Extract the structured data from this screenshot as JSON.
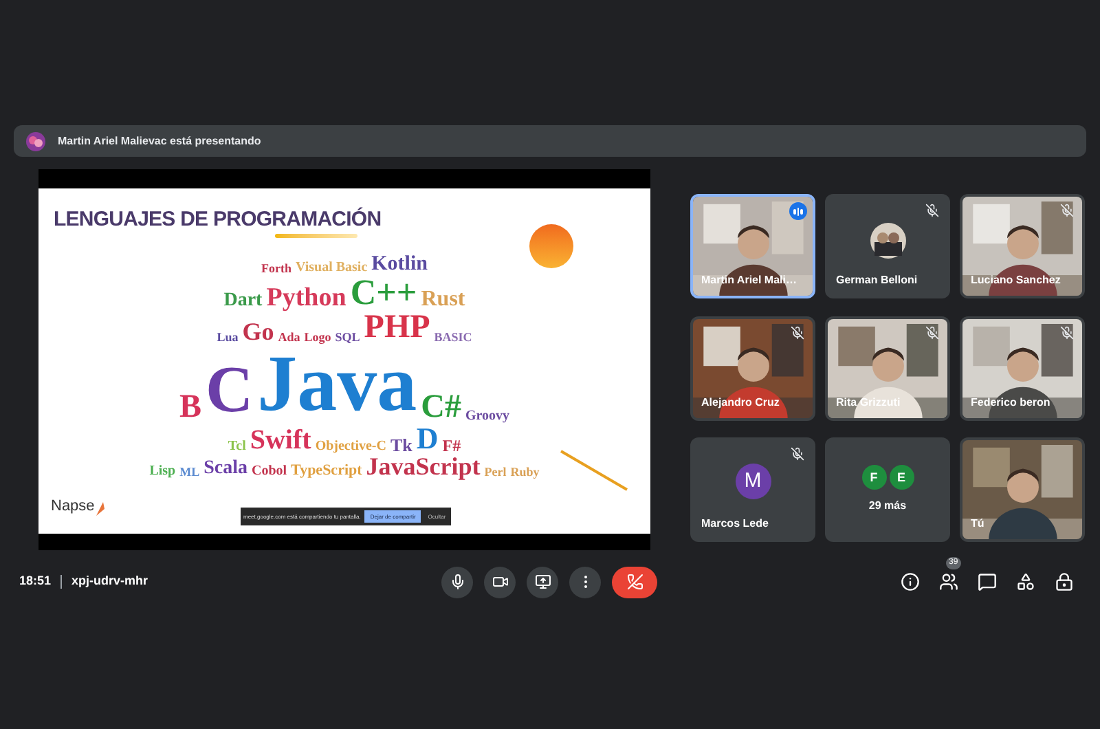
{
  "presenter_banner": {
    "text": "Martin Ariel Malievac está presentando"
  },
  "slide": {
    "title": "LENGUAJES DE PROGRAMACIÓN",
    "logo": "Napse",
    "word_rows": [
      [
        {
          "text": "Forth",
          "color": "#c2334d"
        },
        {
          "text": "Visual Basic",
          "color": "#e0b060"
        },
        {
          "text": "Kotlin",
          "color": "#5a4ba0"
        }
      ],
      [
        {
          "text": "Dart",
          "color": "#3a9a4a"
        },
        {
          "text": "Python",
          "color": "#d63a5a"
        },
        {
          "text": "C++",
          "color": "#2a9d3c"
        },
        {
          "text": "Rust",
          "color": "#d9a055"
        }
      ],
      [
        {
          "text": "Lua",
          "color": "#5a4ba0"
        },
        {
          "text": "Go",
          "color": "#c2334d"
        },
        {
          "text": "Ada",
          "color": "#c2334d"
        },
        {
          "text": "Logo",
          "color": "#c2334d"
        },
        {
          "text": "SQL",
          "color": "#6b4ba0"
        },
        {
          "text": "PHP",
          "color": "#d8334a"
        },
        {
          "text": "BASIC",
          "color": "#8a6bb0"
        }
      ],
      [
        {
          "text": "B",
          "color": "#d6335a"
        },
        {
          "text": "C",
          "color": "#6b3fa8"
        },
        {
          "text": "Java",
          "color": "#1e7fd1"
        },
        {
          "text": "C#",
          "color": "#2a9d3c"
        },
        {
          "text": "Groovy",
          "color": "#6b4ba0"
        }
      ],
      [
        {
          "text": "Tcl",
          "color": "#8bc34a"
        },
        {
          "text": "Swift",
          "color": "#d6335a"
        },
        {
          "text": "Objective-C",
          "color": "#e0a040"
        },
        {
          "text": "Tk",
          "color": "#6b4ba0"
        },
        {
          "text": "D",
          "color": "#1e7fd1"
        },
        {
          "text": "F#",
          "color": "#c2334d"
        }
      ],
      [
        {
          "text": "Lisp",
          "color": "#4caf50"
        },
        {
          "text": "ML",
          "color": "#5a8ad0"
        },
        {
          "text": "Scala",
          "color": "#6b3fa8"
        },
        {
          "text": "Cobol",
          "color": "#c2334d"
        },
        {
          "text": "TypeScript",
          "color": "#e0a040"
        },
        {
          "text": "JavaScript",
          "color": "#c2334d"
        },
        {
          "text": "Perl",
          "color": "#d9a055"
        },
        {
          "text": "Ruby",
          "color": "#d9a055"
        }
      ]
    ],
    "share_bar": {
      "message": "meet.google.com está compartiendo tu pantalla.",
      "stop_button": "Dejar de compartir",
      "hide_button": "Ocultar"
    }
  },
  "participants": [
    {
      "name": "Martin Ariel Mali…",
      "kind": "video",
      "muted": false,
      "speaking": true
    },
    {
      "name": "German Belloni",
      "kind": "avatar",
      "muted": true,
      "speaking": false
    },
    {
      "name": "Luciano Sanchez",
      "kind": "video",
      "muted": true,
      "speaking": false
    },
    {
      "name": "Alejandro Cruz",
      "kind": "video",
      "muted": true,
      "speaking": false
    },
    {
      "name": "Rita Grizzuti",
      "kind": "video",
      "muted": true,
      "speaking": false
    },
    {
      "name": "Federico beron",
      "kind": "video",
      "muted": true,
      "speaking": false
    },
    {
      "name": "Marcos Lede",
      "kind": "initial",
      "initial": "M",
      "color": "#6b3fa8",
      "muted": true,
      "speaking": false
    },
    {
      "kind": "more",
      "label": "29 más",
      "initials": [
        {
          "letter": "F",
          "color": "#1e8e3e"
        },
        {
          "letter": "E",
          "color": "#1e8e3e"
        }
      ]
    },
    {
      "name": "Tú",
      "kind": "video",
      "muted": false,
      "speaking": false
    }
  ],
  "call": {
    "time": "18:51",
    "code": "xpj-udrv-mhr"
  },
  "controls": [
    {
      "kind": "mic"
    },
    {
      "kind": "camera"
    },
    {
      "kind": "present"
    },
    {
      "kind": "more"
    },
    {
      "kind": "hangup"
    }
  ],
  "side_controls": [
    {
      "kind": "info"
    },
    {
      "kind": "people",
      "badge": "39"
    },
    {
      "kind": "chat"
    },
    {
      "kind": "activities"
    },
    {
      "kind": "host"
    }
  ]
}
